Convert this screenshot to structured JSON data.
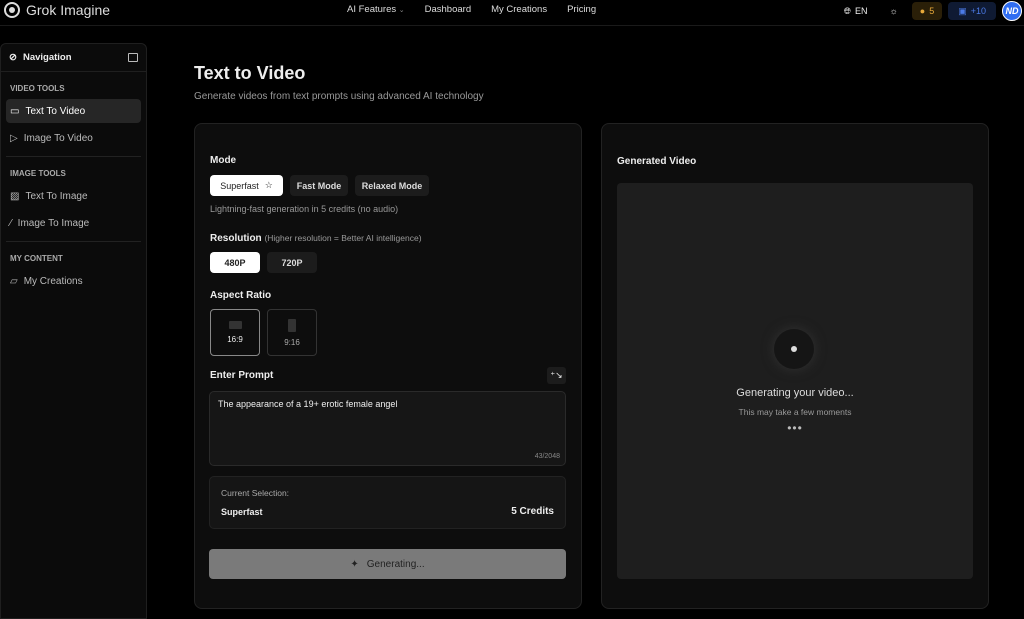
{
  "header": {
    "brand": "Grok Imagine",
    "nav": [
      "AI Features",
      "Dashboard",
      "My Creations",
      "Pricing"
    ],
    "lang": "EN",
    "credits": "5",
    "gift": "+10",
    "avatar": "ND"
  },
  "sidebar": {
    "title": "Navigation",
    "sections": [
      {
        "title": "VIDEO TOOLS",
        "items": [
          "Text To Video",
          "Image To Video"
        ]
      },
      {
        "title": "IMAGE TOOLS",
        "items": [
          "Text To Image",
          "Image To Image"
        ]
      },
      {
        "title": "MY CONTENT",
        "items": [
          "My Creations"
        ]
      }
    ]
  },
  "page": {
    "title": "Text to Video",
    "subtitle": "Generate videos from text prompts using advanced AI technology"
  },
  "form": {
    "mode_label": "Mode",
    "modes": [
      "Superfast",
      "Fast Mode",
      "Relaxed Mode"
    ],
    "mode_desc": "Lightning-fast generation in 5 credits (no audio)",
    "resolution_label": "Resolution",
    "resolution_hint": "(Higher resolution = Better AI intelligence)",
    "resolutions": [
      "480P",
      "720P"
    ],
    "aspect_label": "Aspect Ratio",
    "aspects": [
      "16:9",
      "9:16"
    ],
    "prompt_label": "Enter Prompt",
    "prompt_value": "The appearance of a 19+ erotic female angel",
    "char_count": "43/2048",
    "selection_label": "Current Selection:",
    "selection_mode": "Superfast",
    "selection_credits": "5 Credits",
    "generate_label": "Generating..."
  },
  "preview": {
    "title": "Generated Video",
    "status": "Generating your video...",
    "hint": "This may take a few moments"
  }
}
